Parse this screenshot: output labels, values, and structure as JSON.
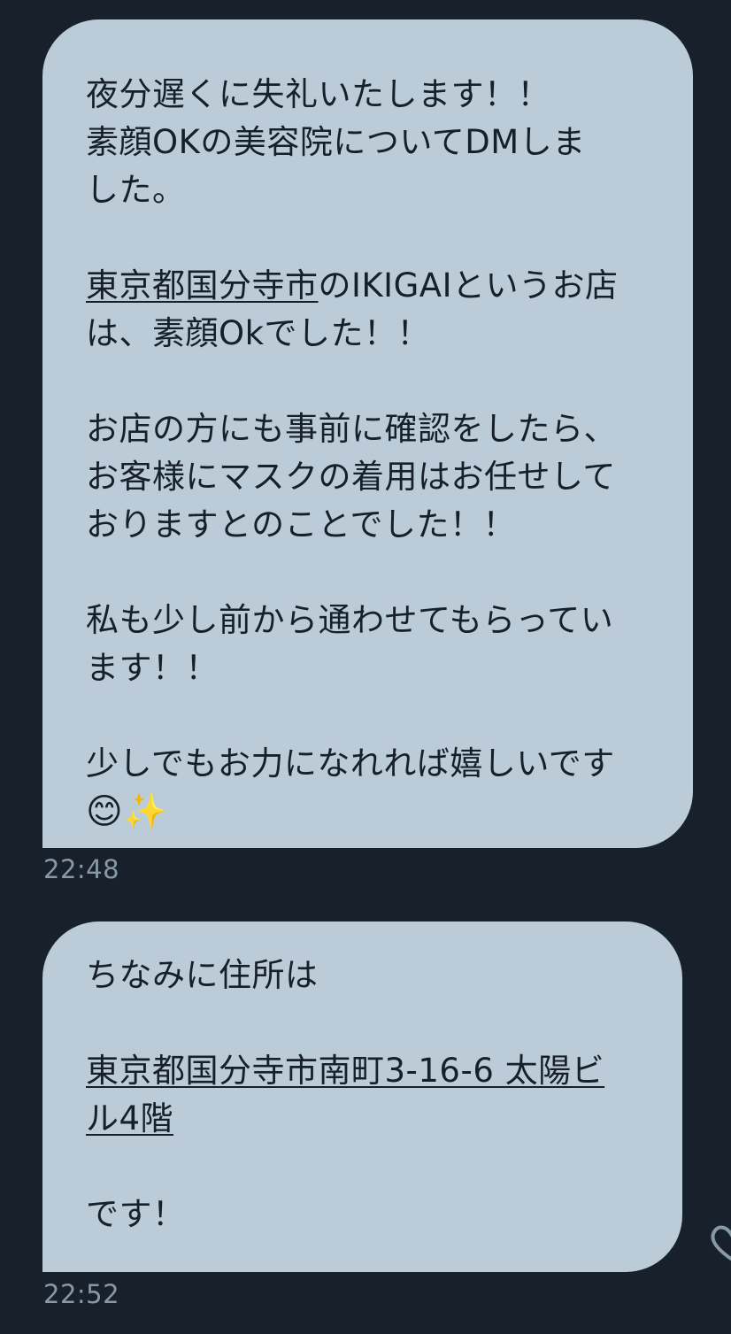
{
  "messages": [
    {
      "time": "22:48",
      "lines": {
        "l1": "夜分遅くに失礼いたします！！",
        "l2": "素顔OKの美容院についてDMしま",
        "l3": "した。",
        "l4_link": "東京都国分寺市",
        "l4_rest": "のIKIGAIというお店",
        "l5": "は、素顔Okでした！！",
        "l6": "お店の方にも事前に確認をしたら、",
        "l7": "お客様にマスクの着用はお任せして",
        "l8": "おりますとのことでした！！",
        "l9": "私も少し前から通わせてもらってい",
        "l10": "ます！！",
        "l11": "少しでもお力になれれば嬉しいです",
        "emoji": "😊✨"
      }
    },
    {
      "time": "22:52",
      "lines": {
        "l1": "ちなみに住所は",
        "l2_link": "東京都国分寺市南町3-16-6 太陽ビ",
        "l3_link": "ル4階",
        "l4": "です！"
      }
    }
  ],
  "icons": {
    "like": "heart-icon"
  },
  "colors": {
    "background": "#17202b",
    "bubble": "#bccbd8",
    "text": "#16202a",
    "timestamp": "#8899a6"
  }
}
